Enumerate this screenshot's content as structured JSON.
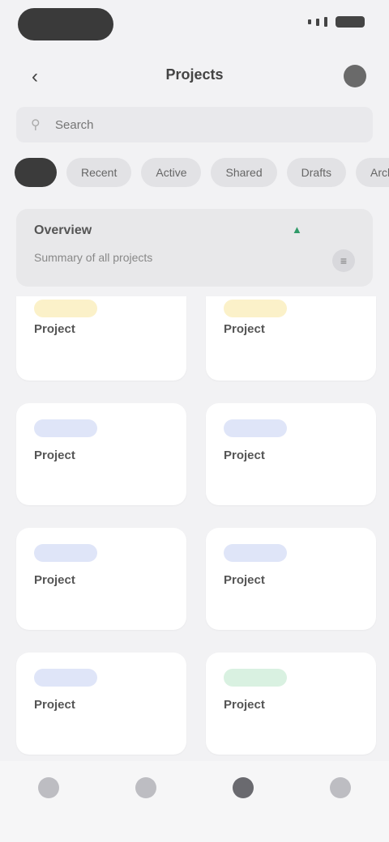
{
  "status": {
    "time": ""
  },
  "appbar": {
    "title": "Projects",
    "back_icon": "chevron-left-icon",
    "profile_icon": "avatar-icon"
  },
  "search": {
    "placeholder": "Search"
  },
  "filters": {
    "chips": [
      {
        "label": ""
      },
      {
        "label": "Recent"
      },
      {
        "label": "Active"
      },
      {
        "label": "Shared"
      },
      {
        "label": "Drafts"
      },
      {
        "label": "Archived"
      }
    ]
  },
  "summary": {
    "heading": "Overview",
    "sub": "Summary of all projects",
    "trend": "▲",
    "filter_icon": "filter-icon"
  },
  "colors": {
    "badge_yellow_bg": "#fbf1c9",
    "badge_yellow_fg": "#b99a2e",
    "badge_blue_bg": "#dfe5f8",
    "badge_blue_fg": "#4c5fa8",
    "badge_green_bg": "#d9f1e1",
    "badge_green_fg": "#2f8a55"
  },
  "cards": [
    {
      "badge": "",
      "badge_tone": "yellow",
      "name": "Project",
      "meta": ""
    },
    {
      "badge": "",
      "badge_tone": "yellow",
      "name": "Project",
      "meta": ""
    },
    {
      "badge": "",
      "badge_tone": "blue",
      "name": "Project",
      "meta": ""
    },
    {
      "badge": "",
      "badge_tone": "blue",
      "name": "Project",
      "meta": ""
    },
    {
      "badge": "",
      "badge_tone": "blue",
      "name": "Project",
      "meta": ""
    },
    {
      "badge": "",
      "badge_tone": "blue",
      "name": "Project",
      "meta": ""
    },
    {
      "badge": "",
      "badge_tone": "blue",
      "name": "Project",
      "meta": ""
    },
    {
      "badge": "",
      "badge_tone": "green",
      "name": "Project",
      "meta": ""
    }
  ],
  "tabbar": {
    "tabs": [
      {
        "icon": "home-icon"
      },
      {
        "icon": "search-icon"
      },
      {
        "icon": "folder-icon"
      },
      {
        "icon": "settings-icon"
      }
    ],
    "active_index": 2
  }
}
